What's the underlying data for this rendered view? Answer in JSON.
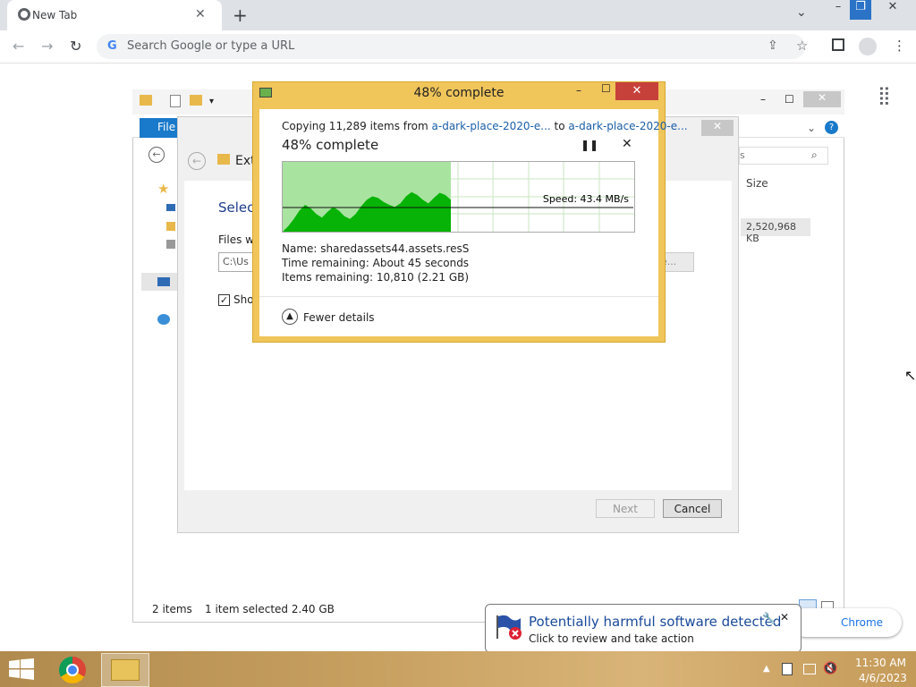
{
  "chrome": {
    "tab_title": "New Tab",
    "omnibox_placeholder": "Search Google or type a URL",
    "hint": "Chrome"
  },
  "explorer": {
    "file_tab": "File",
    "size_header": "Size",
    "size_value": "2,520,968 KB",
    "status_items": "2 items",
    "status_selected": "1 item selected  2.40 GB",
    "breadcrumb_partial": "Ext"
  },
  "wizard": {
    "heading_partial": "Selec",
    "files_label_partial": "Files wi",
    "path_partial": "C:\\Us",
    "browse_partial": "e...",
    "show_partial": "Sho",
    "next_label": "Next",
    "cancel_label": "Cancel"
  },
  "copy": {
    "window_title": "48% complete",
    "line_prefix": "Copying 11,289 items from ",
    "source": "a-dark-place-2020-e...",
    "to_word": " to ",
    "destination": "a-dark-place-2020-e...",
    "percent_text": "48% complete",
    "progress_fraction": 0.48,
    "speed": "Speed: 43.4 MB/s",
    "name_line": "Name:  sharedassets44.assets.resS",
    "time_line": "Time remaining:  About 45 seconds",
    "items_line": "Items remaining:  10,810 (2.21 GB)",
    "fewer_details": "Fewer details"
  },
  "notification": {
    "title": "Potentially harmful software detected",
    "subtitle": "Click to review and take action"
  },
  "taskbar": {
    "time": "11:30 AM",
    "date": "4/6/2023"
  },
  "colors": {
    "copy_frame": "#f0c55a",
    "graph_fill": "#06b306",
    "graph_bg": "#a9e3a0",
    "notif_title": "#1a4a9a"
  }
}
